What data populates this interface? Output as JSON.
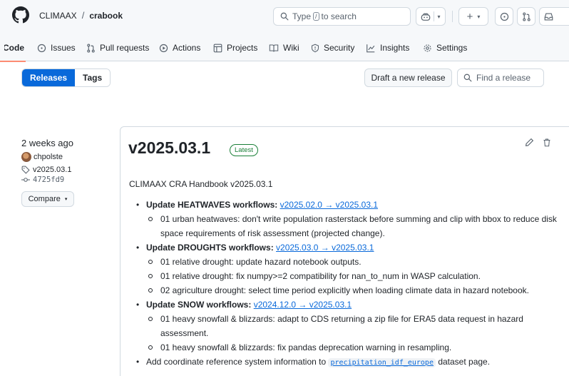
{
  "header": {
    "owner": "CLIMAAX",
    "separator": "/",
    "repo": "crabook",
    "search_before": "Type",
    "search_key": "/",
    "search_after": "to search",
    "plus_label": "+",
    "caret": "▾"
  },
  "nav": {
    "tabs": [
      {
        "label": "Code",
        "icon": "code-icon"
      },
      {
        "label": "Issues",
        "icon": "issue-icon"
      },
      {
        "label": "Pull requests",
        "icon": "pull-request-icon"
      },
      {
        "label": "Actions",
        "icon": "play-icon"
      },
      {
        "label": "Projects",
        "icon": "table-icon"
      },
      {
        "label": "Wiki",
        "icon": "book-icon"
      },
      {
        "label": "Security",
        "icon": "shield-icon"
      },
      {
        "label": "Insights",
        "icon": "graph-icon"
      },
      {
        "label": "Settings",
        "icon": "gear-icon"
      }
    ]
  },
  "subnav": {
    "releases": "Releases",
    "tags": "Tags",
    "draft_button": "Draft a new release",
    "find_placeholder": "Find a release"
  },
  "release": {
    "date": "2 weeks ago",
    "author": "chpolste",
    "tag": "v2025.03.1",
    "commit": "4725fd9",
    "compare": "Compare",
    "title": "v2025.03.1",
    "badge": "Latest",
    "intro": "CLIMAAX CRA Handbook v2025.03.1",
    "notes": {
      "heat": {
        "label": "Update HEATWAVES workflows",
        "link": "v2025.02.0 → v2025.03.1",
        "items": [
          "01 urban heatwaves: don't write population rasterstack before summing and clip with bbox to reduce disk space requirements of risk assessment (projected change)."
        ]
      },
      "drought": {
        "label": "Update DROUGHTS workflows",
        "link": "v2025.03.0 → v2025.03.1",
        "items": [
          "01 relative drought: update hazard notebook outputs.",
          "01 relative drought: fix numpy>=2 compatibility for nan_to_num in WASP calculation.",
          "02 agriculture drought: select time period explicitly when loading climate data in hazard notebook."
        ]
      },
      "snow": {
        "label": "Update SNOW workflows",
        "link": "v2024.12.0 → v2025.03.1",
        "items": [
          "01 heavy snowfall & blizzards: adapt to CDS returning a zip file for ERA5 data request in hazard assessment.",
          "01 heavy snowfall & blizzards: fix pandas deprecation warning in resampling."
        ]
      },
      "crs": {
        "before": "Add coordinate reference system information to",
        "code": "precipitation_idf_europe",
        "after": "dataset page."
      }
    }
  },
  "colors": {
    "accent": "#0969da",
    "latest_green": "#1a7f37",
    "active_tab_underline": "#fd8c73"
  }
}
